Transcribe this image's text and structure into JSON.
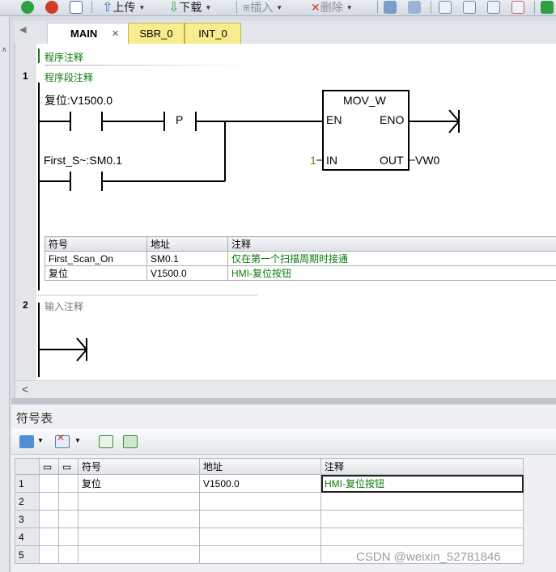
{
  "toolbar": {
    "upload_label": "上传",
    "download_label": "下载",
    "insert_label": "插入",
    "delete_label": "删除"
  },
  "tabs": [
    {
      "label": "MAIN",
      "close": "×"
    },
    {
      "label": "SBR_0"
    },
    {
      "label": "INT_0"
    }
  ],
  "program": {
    "comment": "程序注释",
    "networks": [
      {
        "number": "1",
        "comment": "程序段注释",
        "contact1_symbol": "复位:V1500.0",
        "contact2_symbol": "First_S~:SM0.1",
        "p_label": "P",
        "box": {
          "name": "MOV_W",
          "en": "EN",
          "eno": "ENO",
          "in": "IN",
          "out": "OUT",
          "in_value": "1",
          "out_value": "VW0"
        },
        "symbol_table": {
          "headers": [
            "符号",
            "地址",
            "注释"
          ],
          "rows": [
            [
              "First_Scan_On",
              "SM0.1",
              "仅在第一个扫描周期时接通"
            ],
            [
              "复位",
              "V1500.0",
              "HMI-复位按钮"
            ]
          ]
        }
      },
      {
        "number": "2",
        "comment": "输入注释"
      }
    ]
  },
  "scroll_left": "<",
  "symbol_panel": {
    "title": "符号表",
    "headers": [
      "符号",
      "地址",
      "注释"
    ],
    "rows": [
      {
        "num": "1",
        "symbol": "复位",
        "address": "V1500.0",
        "comment": "HMI-复位按钮"
      },
      {
        "num": "2",
        "symbol": "",
        "address": "",
        "comment": ""
      },
      {
        "num": "3",
        "symbol": "",
        "address": "",
        "comment": ""
      },
      {
        "num": "4",
        "symbol": "",
        "address": "",
        "comment": ""
      },
      {
        "num": "5",
        "symbol": "",
        "address": "",
        "comment": ""
      }
    ]
  },
  "watermark": "CSDN @weixin_52781846",
  "colors": {
    "comment_green": "#0a7a0a",
    "tab_yellow": "#f8ec8e"
  }
}
